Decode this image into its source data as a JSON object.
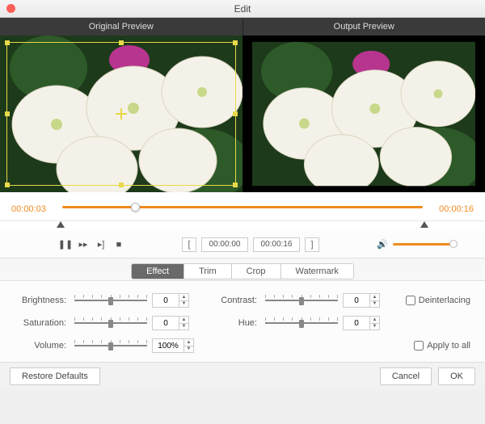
{
  "window": {
    "title": "Edit"
  },
  "preview": {
    "original_label": "Original Preview",
    "output_label": "Output Preview"
  },
  "timeline": {
    "current": "00:00:03",
    "total": "00:00:16",
    "progress_pct": 19
  },
  "trim_range": {
    "start": "00:00:00",
    "end": "00:00:16"
  },
  "tabs": {
    "effect": "Effect",
    "trim": "Trim",
    "crop": "Crop",
    "watermark": "Watermark",
    "active": "effect"
  },
  "effects": {
    "brightness": {
      "label": "Brightness:",
      "value": "0"
    },
    "contrast": {
      "label": "Contrast:",
      "value": "0"
    },
    "saturation": {
      "label": "Saturation:",
      "value": "0"
    },
    "hue": {
      "label": "Hue:",
      "value": "0"
    },
    "volume": {
      "label": "Volume:",
      "value": "100%"
    }
  },
  "checkboxes": {
    "deinterlacing": "Deinterlacing",
    "apply_all": "Apply to all"
  },
  "buttons": {
    "restore": "Restore Defaults",
    "cancel": "Cancel",
    "ok": "OK"
  },
  "icons": {
    "pause": "❚❚",
    "next_frame": "▸▸",
    "step": "▸]",
    "stop": "■",
    "bracket_open": "[",
    "bracket_close": "]",
    "volume": "🔊"
  },
  "colors": {
    "accent": "#f08b1f",
    "crop_handle": "#e8d84a"
  }
}
